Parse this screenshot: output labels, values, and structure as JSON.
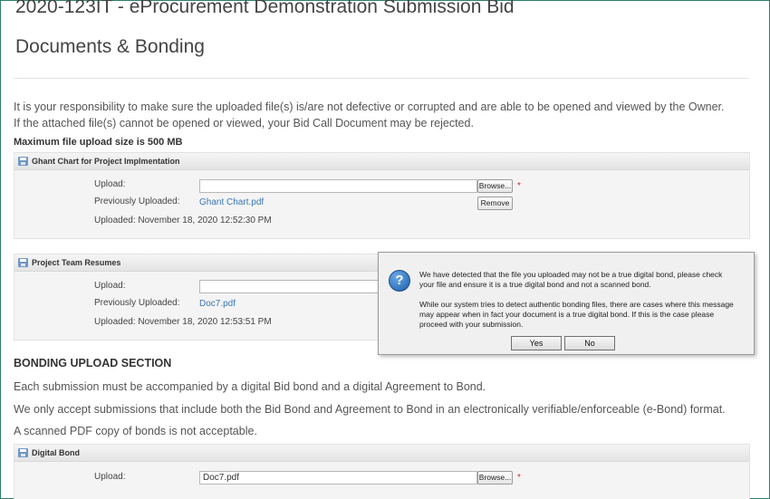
{
  "page": {
    "title": "2020-123IT - eProcurement Demonstration Submission Bid",
    "subtitle": "Documents & Bonding",
    "intro": "It is your responsibility to make sure the uploaded file(s) is/are not defective or corrupted and are able to be opened and viewed by the Owner. If the attached file(s) cannot be opened or viewed, your Bid Call Document may be rejected.",
    "max_size": "Maximum file upload size is 500 MB"
  },
  "panels": [
    {
      "heading": "Ghant Chart for Project Implmentation",
      "upload_label": "Upload:",
      "upload_value": "",
      "browse_label": "Browse...",
      "required_mark": "*",
      "previous_label": "Previously Uploaded:",
      "previous_file": "Ghant Chart.pdf",
      "remove_label": "Remove",
      "uploaded_info": "Uploaded: November 18, 2020 12:52:30 PM"
    },
    {
      "heading": "Project Team Resumes",
      "upload_label": "Upload:",
      "upload_value": "",
      "previous_label": "Previously Uploaded:",
      "previous_file": "Doc7.pdf",
      "uploaded_info": "Uploaded: November 18, 2020 12:53:51 PM"
    },
    {
      "heading": "Digital Bond",
      "upload_label": "Upload:",
      "upload_value": "Doc7.pdf",
      "browse_label": "Browse...",
      "required_mark": "*"
    }
  ],
  "bonding": {
    "title": "BONDING UPLOAD SECTION",
    "line1": "Each submission must be accompanied by a digital Bid bond and a digital Agreement to Bond.",
    "line2": "We only accept submissions that include both the Bid Bond and Agreement to Bond in an electronically verifiable/enforceable (e-Bond) format.",
    "line3": "A scanned PDF copy of bonds is not acceptable."
  },
  "dialog": {
    "icon": "question-icon",
    "message1": "We have detected that the file you uploaded may not be a true digital bond, please check your file and ensure it is a true digital bond and not a scanned bond.",
    "message2": "While our system tries to detect authentic bonding files, there are cases where this message may appear when in fact your document is a true digital bond. If this is the case please proceed with your submission.",
    "yes_label": "Yes",
    "no_label": "No"
  },
  "colors": {
    "link": "#3a78b5",
    "required": "#cc2a2a",
    "frame": "#2e7d6b"
  }
}
